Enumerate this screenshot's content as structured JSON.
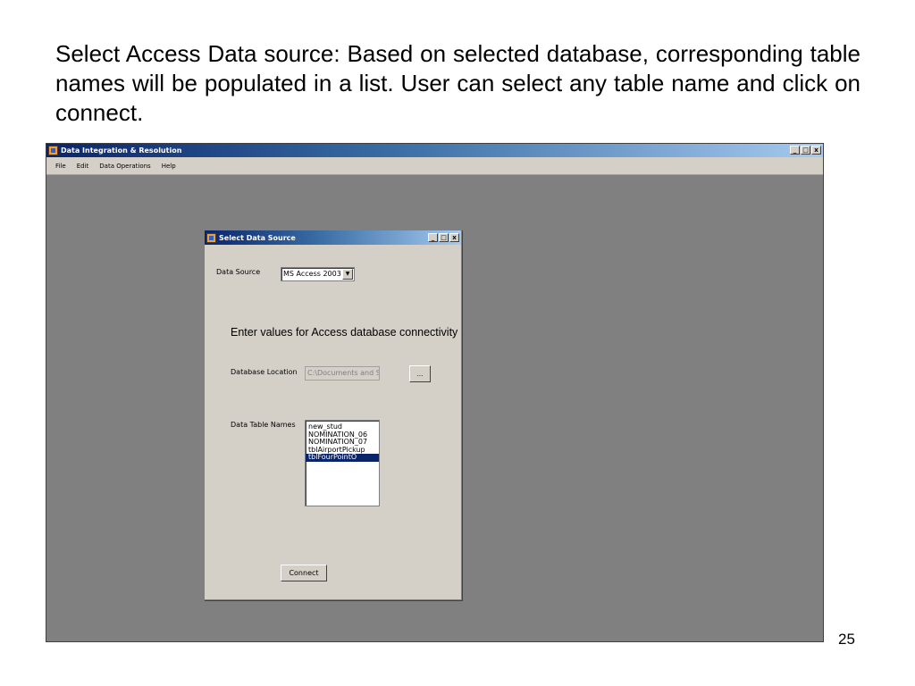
{
  "slide": {
    "text": "Select Access Data source: Based on selected database, corresponding table names will be populated in a list. User can select any table name and click on connect.",
    "page_number": "25"
  },
  "app": {
    "title": "Data Integration & Resolution",
    "menu": [
      "File",
      "Edit",
      "Data Operations",
      "Help"
    ],
    "controls": {
      "minimize": "_",
      "maximize": "□",
      "close": "x"
    }
  },
  "dialog": {
    "title": "Select Data Source",
    "data_source_label": "Data Source",
    "data_source_value": "MS Access 2003",
    "heading": "Enter values for Access database connectivity",
    "db_location_label": "Database Location",
    "db_location_value": "C:\\Documents and Setti",
    "browse_label": "...",
    "table_names_label": "Data Table Names",
    "tables": [
      "new_stud",
      "NOMINATION_06",
      "NOMINATION_07",
      "tblAirportPickup",
      "tblFourPointO"
    ],
    "selected_table": "tblFourPointO",
    "connect_label": "Connect"
  }
}
